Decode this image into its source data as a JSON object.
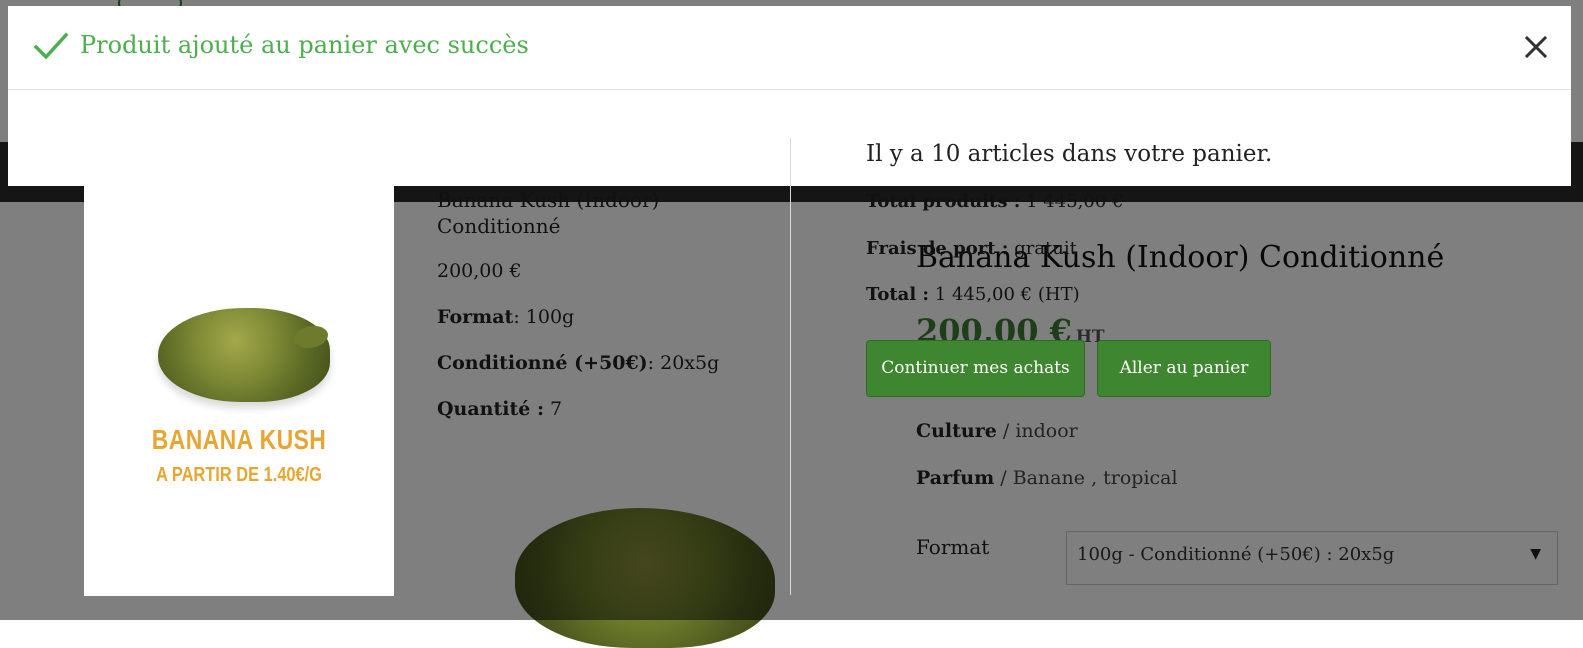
{
  "modal": {
    "title": "Produit ajouté au panier avec succès",
    "cart_summary": "Il y a 10 articles dans votre panier.",
    "product": {
      "name": "Banana Kush (Indoor) Conditionné",
      "price": "200,00 €",
      "format_label": "Format",
      "format_value": ": 100g",
      "packaging_label": "Conditionné (+50€)",
      "packaging_value": ": 20x5g",
      "quantity_label": "Quantité :",
      "quantity_value": "7",
      "image_brand": "BANANA KUSH",
      "image_tagline": "A PARTIR DE 1.40€/G"
    },
    "totals": {
      "products_label": "Total produits :",
      "products_value": "1 445,00 €",
      "shipping_label": "Frais de port :",
      "shipping_value": "gratuit",
      "total_label": "Total :",
      "total_value": "1 445,00 € (HT)"
    },
    "buttons": {
      "continue": "Continuer mes achats",
      "cart": "Aller au panier"
    }
  },
  "background_page": {
    "product_title": "Banana Kush (Indoor) Conditionné",
    "price": "200,00 €",
    "price_suffix": "HT",
    "culture_label": "Culture",
    "culture_value": "/ indoor",
    "parfum_label": "Parfum",
    "parfum_value": "/ Banane , tropical",
    "format_label": "Format",
    "format_selected": "100g - Conditionné (+50€) : 20x5g"
  },
  "colors": {
    "success": "#4cae4c",
    "button": "#3e862f",
    "price": "#3c7d33",
    "brand_text": "#e8a531"
  }
}
